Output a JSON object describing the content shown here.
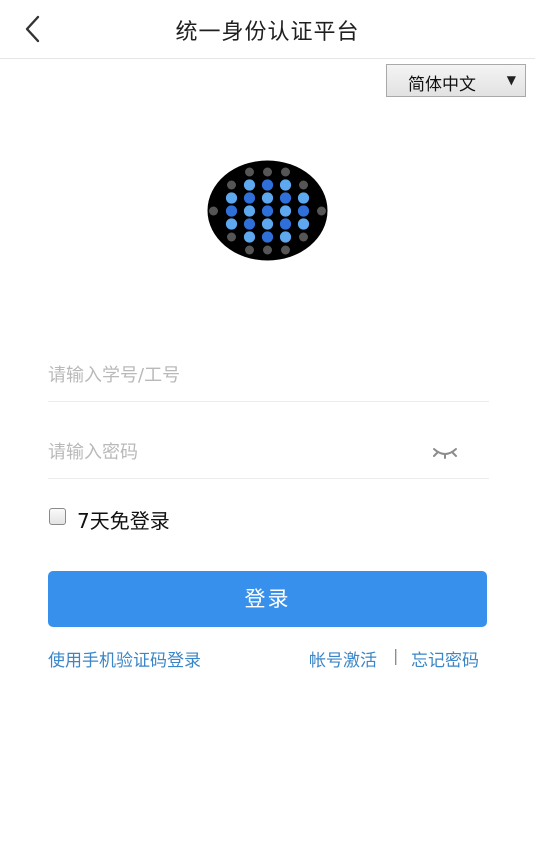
{
  "header": {
    "title": "统一身份认证平台",
    "back_icon": "chevron-left-icon"
  },
  "language": {
    "selected": "简体中文",
    "arrow_glyph": "▼"
  },
  "logo": {
    "icon": "dot-matrix-logo-icon",
    "colors": {
      "background": "#000000",
      "dot_blue": "#2f6fd9",
      "dot_light_blue": "#5ea8ef",
      "dot_gray": "#555555"
    }
  },
  "form": {
    "username_placeholder": "请输入学号/工号",
    "username_value": "",
    "password_placeholder": "请输入密码",
    "password_value": "",
    "eye_icon": "eye-closed-icon",
    "remember_label": "7天免登录",
    "remember_checked": false,
    "login_label": "登录"
  },
  "links": {
    "sms_login": "使用手机验证码登录",
    "activate": "帐号激活",
    "separator": "|",
    "forgot": "忘记密码"
  },
  "colors": {
    "accent": "#3790ec",
    "link": "#3a86c8",
    "placeholder": "#b9b9b9"
  }
}
